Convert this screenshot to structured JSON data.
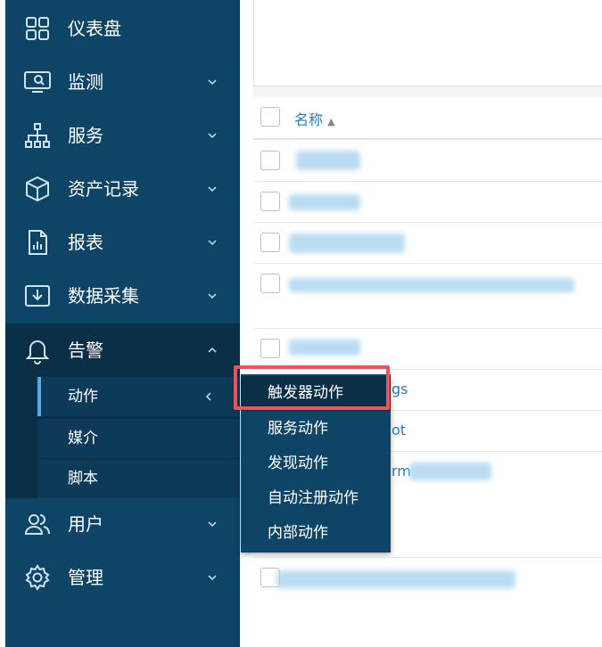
{
  "sidebar": {
    "items": [
      {
        "label": "仪表盘",
        "icon": "grid-icon"
      },
      {
        "label": "监测",
        "icon": "monitor-icon"
      },
      {
        "label": "服务",
        "icon": "hierarchy-icon"
      },
      {
        "label": "资产记录",
        "icon": "box-icon"
      },
      {
        "label": "报表",
        "icon": "report-icon"
      },
      {
        "label": "数据采集",
        "icon": "download-icon"
      },
      {
        "label": "告警",
        "icon": "bell-icon"
      },
      {
        "label": "用户",
        "icon": "users-icon"
      },
      {
        "label": "管理",
        "icon": "gear-icon"
      }
    ],
    "alert_submenu": [
      {
        "label": "动作",
        "active": true
      },
      {
        "label": "媒介"
      },
      {
        "label": "脚本"
      }
    ]
  },
  "flyout": {
    "items": [
      {
        "label": "触发器动作"
      },
      {
        "label": "服务动作"
      },
      {
        "label": "发现动作"
      },
      {
        "label": "自动注册动作"
      },
      {
        "label": "内部动作"
      }
    ]
  },
  "table": {
    "header_name": "名称",
    "sort_indicator": "▲",
    "visible_fragments": [
      "gs",
      "ot",
      "rm"
    ]
  },
  "colors": {
    "sidebar_bg": "#0e4465",
    "sidebar_dark": "#0a2f46",
    "link": "#1f7ec2",
    "highlight": "#f0525a"
  }
}
